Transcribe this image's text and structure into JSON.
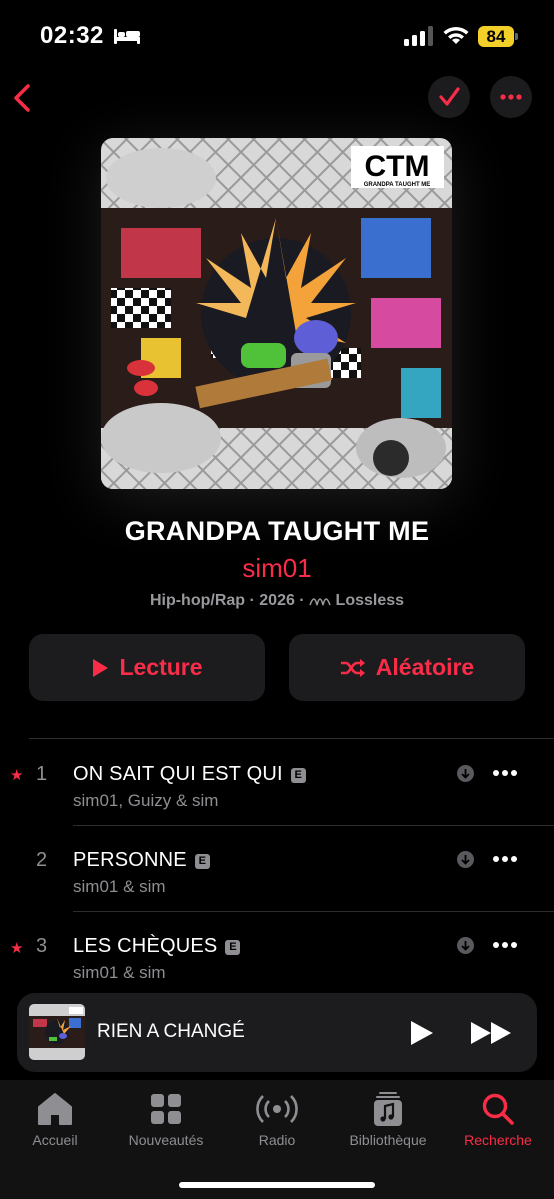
{
  "status_bar": {
    "time": "02:32",
    "battery": "84"
  },
  "album": {
    "title": "GRANDPA TAUGHT ME",
    "artist": "sim01",
    "genre_year": "Hip-hop/Rap · 2026 ·",
    "quality": "Lossless",
    "cover_logo": "CTM",
    "cover_subtitle": "GRANDPA TAUGHT ME"
  },
  "actions": {
    "play_label": "Lecture",
    "shuffle_label": "Aléatoire"
  },
  "tracks": [
    {
      "number": "1",
      "title": "ON SAIT QUI EST QUI",
      "explicit": "E",
      "artists": "sim01, Guizy & sim",
      "favorite": true
    },
    {
      "number": "2",
      "title": "PERSONNE",
      "explicit": "E",
      "artists": "sim01 & sim",
      "favorite": false
    },
    {
      "number": "3",
      "title": "LES CHÈQUES",
      "explicit": "E",
      "artists": "sim01 & sim",
      "favorite": true
    }
  ],
  "mini_player": {
    "title": "RIEN A CHANGÉ"
  },
  "tabs": [
    {
      "label": "Accueil",
      "icon": "home-icon"
    },
    {
      "label": "Nouveautés",
      "icon": "grid-icon"
    },
    {
      "label": "Radio",
      "icon": "radio-icon"
    },
    {
      "label": "Bibliothèque",
      "icon": "library-icon"
    },
    {
      "label": "Recherche",
      "icon": "search-icon",
      "active": true
    }
  ],
  "colors": {
    "accent": "#fa2d48",
    "background": "#000000",
    "surface": "#1c1c1e",
    "battery": "#f2cf29"
  }
}
